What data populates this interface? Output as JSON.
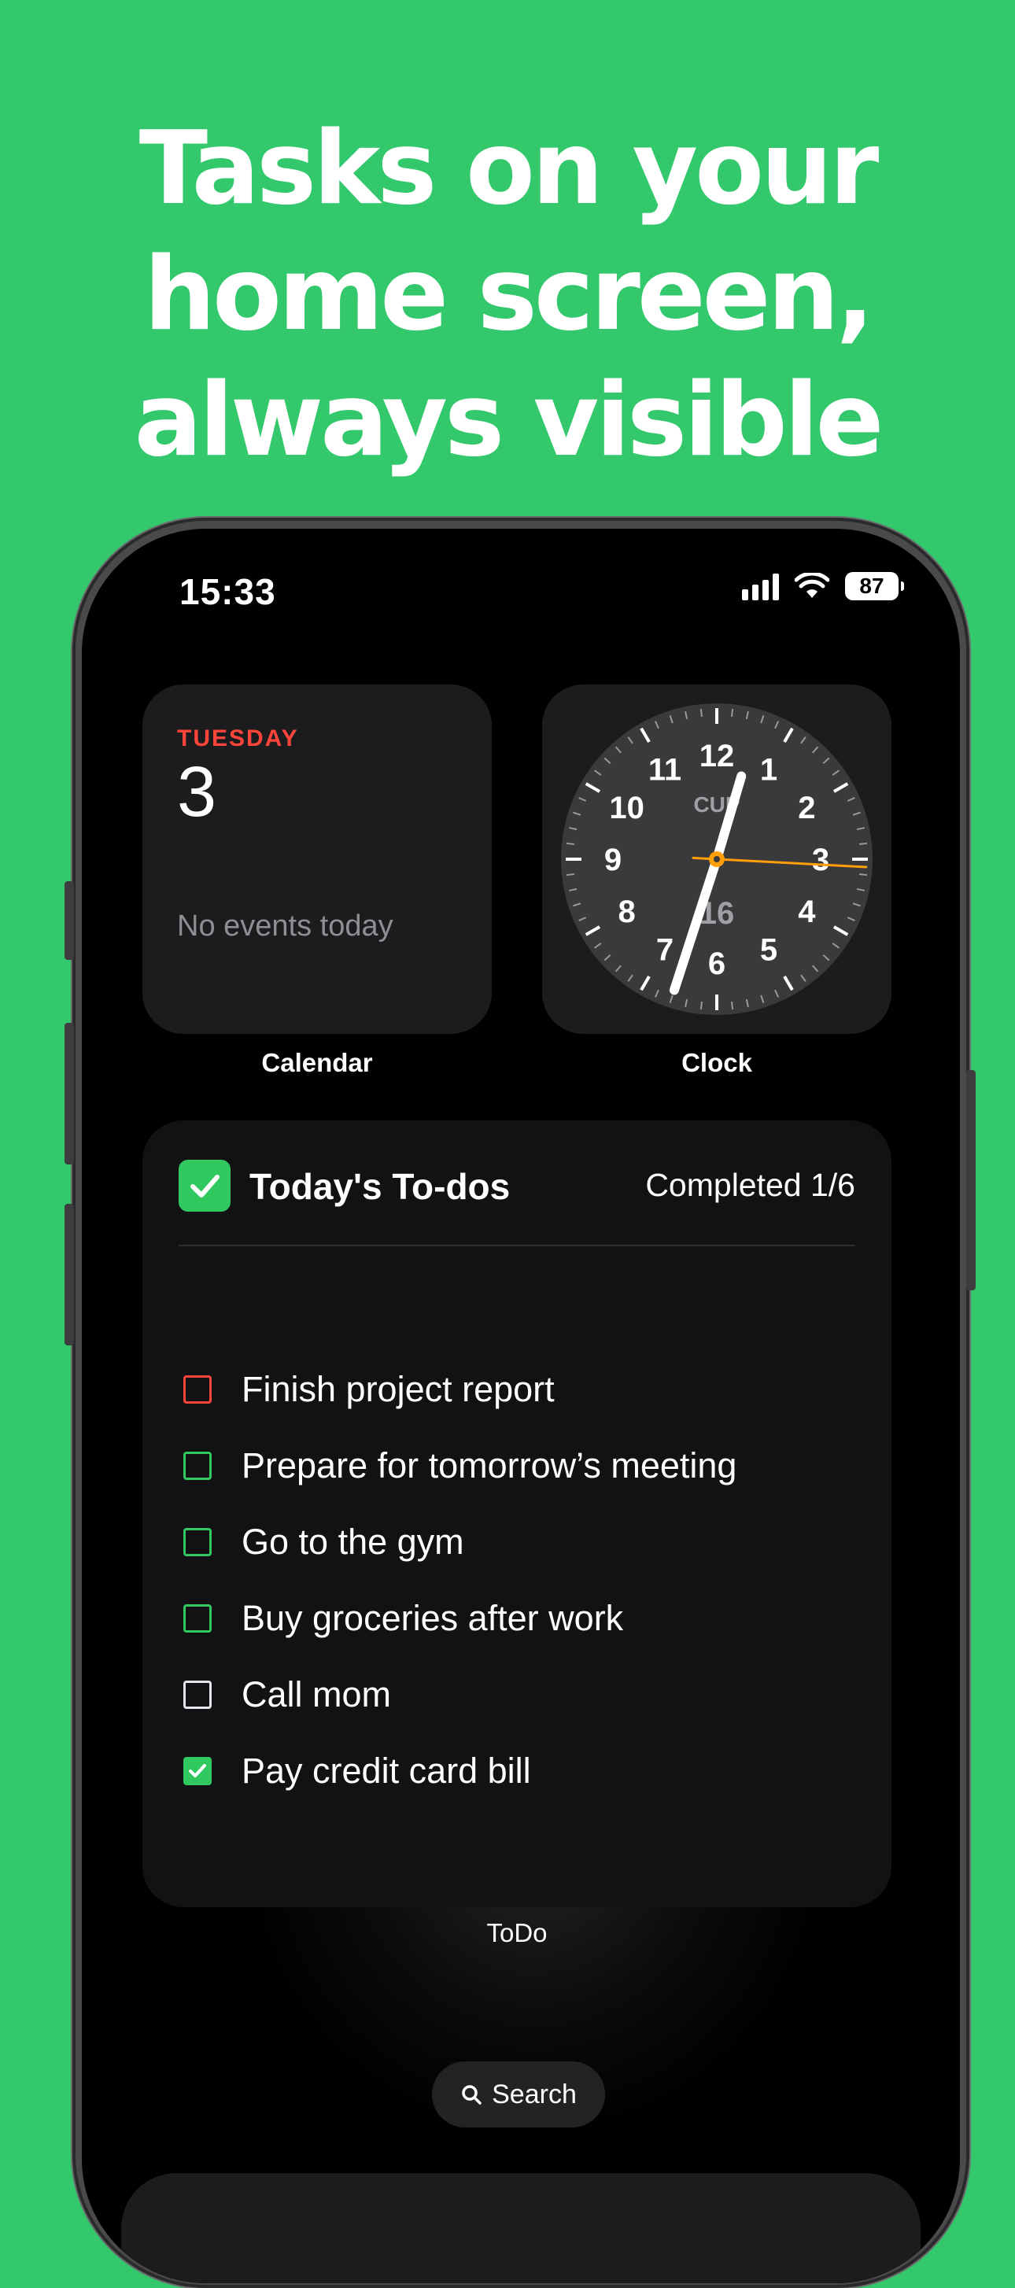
{
  "headline": {
    "line1": "Tasks on your",
    "line2": "home screen,",
    "line3": "always visible"
  },
  "status_bar": {
    "time": "15:33",
    "battery": "87",
    "icons": [
      "signal-icon",
      "wifi-icon",
      "battery-icon"
    ]
  },
  "calendar_widget": {
    "day": "TUESDAY",
    "date": "3",
    "events": "No events today",
    "label": "Calendar"
  },
  "clock_widget": {
    "label": "Clock",
    "city": "CUP",
    "offset": "16",
    "numerals": [
      "12",
      "1",
      "2",
      "3",
      "4",
      "5",
      "6",
      "7",
      "8",
      "9",
      "10",
      "11"
    ],
    "time_shown": "12:33"
  },
  "todo_widget": {
    "title": "Today's To-dos",
    "completed": "Completed 1/6",
    "label": "ToDo",
    "tasks": [
      {
        "label": "Finish project report",
        "state": "red"
      },
      {
        "label": "Prepare for tomorrow’s meeting",
        "state": "green"
      },
      {
        "label": "Go to the gym",
        "state": "green"
      },
      {
        "label": "Buy groceries after work",
        "state": "green"
      },
      {
        "label": "Call mom",
        "state": "white"
      },
      {
        "label": "Pay credit card bill",
        "state": "checked"
      }
    ]
  },
  "search": {
    "label": "Search",
    "icon": "search-icon"
  },
  "colors": {
    "background": "#33c86b",
    "accent_green": "#30c95f",
    "accent_red": "#ff453a",
    "clock_second_hand": "#ff9f0a"
  }
}
